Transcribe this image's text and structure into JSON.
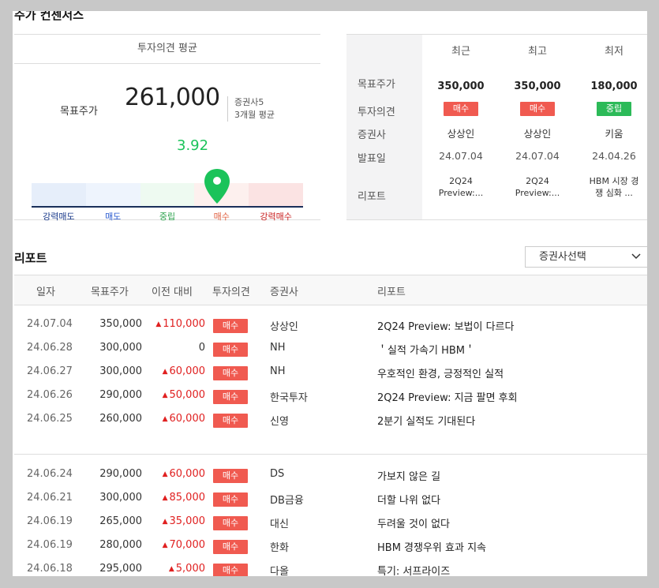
{
  "section_title": "주가 컨센서스",
  "consensus": {
    "header": "투자의견 평균",
    "target_price_label": "목표주가",
    "target_price": "261,000",
    "sub_line1": "증권사5",
    "sub_line2": "3개월 평균",
    "opinion_score": "3.92",
    "opinion_score_value": 3.92,
    "gauge_labels": [
      "강력매도",
      "매도",
      "중립",
      "매수",
      "강력매수"
    ],
    "gauge_colors": [
      "#e6eefa",
      "#eef4fd",
      "#eefaf1",
      "#fdf0ee",
      "#fbe3e3"
    ],
    "gauge_label_colors": [
      "#1a3a8a",
      "#2a5bd0",
      "#2ba24c",
      "#e06040",
      "#c81e1e"
    ],
    "accent_green": "#1bc35a"
  },
  "recent": {
    "columns": [
      "최근",
      "최고",
      "최저"
    ],
    "row_labels": [
      "목표주가",
      "투자의견",
      "증권사",
      "발표일",
      "리포트"
    ],
    "target_prices": [
      "350,000",
      "350,000",
      "180,000"
    ],
    "opinions": [
      "매수",
      "매수",
      "중립"
    ],
    "brokers": [
      "상상인",
      "상상인",
      "키움"
    ],
    "dates": [
      "24.07.04",
      "24.07.04",
      "24.04.26"
    ],
    "reports_line1": [
      "2Q24",
      "2Q24",
      "HBM 시장 경"
    ],
    "reports_line2": [
      "Preview:...",
      "Preview:...",
      "쟁 심화 ..."
    ]
  },
  "report_section": {
    "title": "리포트",
    "broker_select": "증권사선택",
    "headers": [
      "일자",
      "목표주가",
      "이전 대비",
      "투자의견",
      "증권사",
      "리포트"
    ],
    "rows": [
      {
        "date": "24.07.04",
        "price": "350,000",
        "change": "110,000",
        "opinion": "매수",
        "broker": "상상인",
        "report": "2Q24 Preview: 보법이 다르다"
      },
      {
        "date": "24.06.28",
        "price": "300,000",
        "change": "0",
        "opinion": "매수",
        "broker": "NH",
        "report": "＇실적 가속기 HBM＇"
      },
      {
        "date": "24.06.27",
        "price": "300,000",
        "change": "60,000",
        "opinion": "매수",
        "broker": "NH",
        "report": "우호적인 환경, 긍정적인 실적"
      },
      {
        "date": "24.06.26",
        "price": "290,000",
        "change": "50,000",
        "opinion": "매수",
        "broker": "한국투자",
        "report": "2Q24 Preview: 지금 팔면 후회"
      },
      {
        "date": "24.06.25",
        "price": "260,000",
        "change": "60,000",
        "opinion": "매수",
        "broker": "신영",
        "report": "2분기 실적도 기대된다"
      },
      {
        "date": "24.06.24",
        "price": "290,000",
        "change": "60,000",
        "opinion": "매수",
        "broker": "DS",
        "report": "가보지 않은 길"
      },
      {
        "date": "24.06.21",
        "price": "300,000",
        "change": "85,000",
        "opinion": "매수",
        "broker": "DB금융",
        "report": "더할 나위 없다"
      },
      {
        "date": "24.06.19",
        "price": "265,000",
        "change": "35,000",
        "opinion": "매수",
        "broker": "대신",
        "report": "두려울 것이 없다"
      },
      {
        "date": "24.06.19",
        "price": "280,000",
        "change": "70,000",
        "opinion": "매수",
        "broker": "한화",
        "report": "HBM 경쟁우위 효과 지속"
      },
      {
        "date": "24.06.18",
        "price": "295,000",
        "change": "5,000",
        "opinion": "매수",
        "broker": "다올",
        "report": "특기: 서프라이즈"
      }
    ]
  }
}
